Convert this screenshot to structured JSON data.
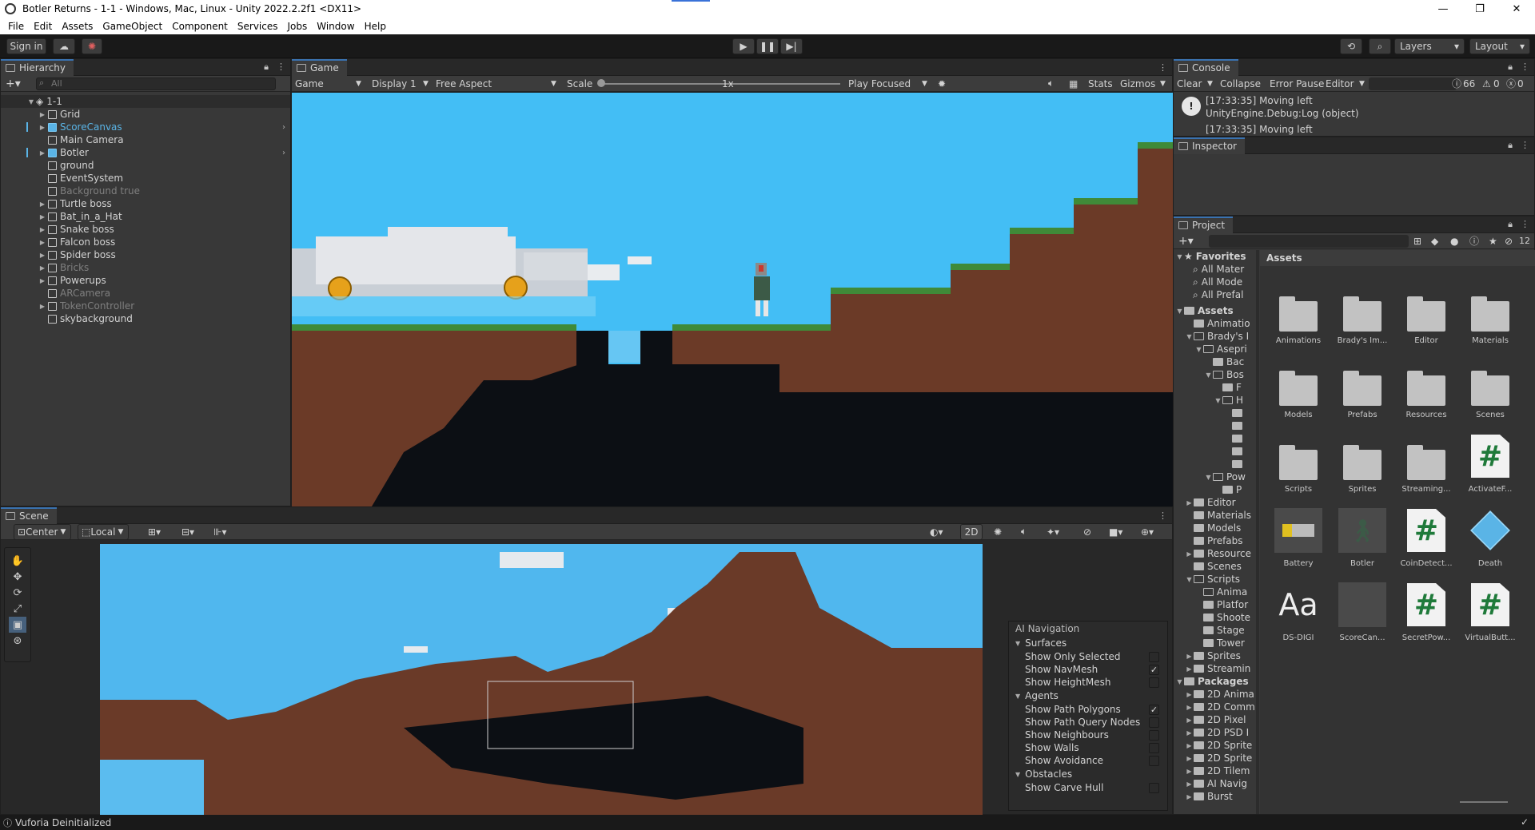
{
  "window": {
    "title": "Botler Returns - 1-1 - Windows, Mac, Linux - Unity 2022.2.2f1 <DX11>",
    "minimize": "—",
    "maximize": "❐",
    "close": "✕"
  },
  "menu": [
    "File",
    "Edit",
    "Assets",
    "GameObject",
    "Component",
    "Services",
    "Jobs",
    "Window",
    "Help"
  ],
  "toolbar": {
    "signin": "Sign in",
    "layers": "Layers",
    "layout": "Layout"
  },
  "hierarchy": {
    "tab": "Hierarchy",
    "search_placeholder": "All",
    "scene": "1-1",
    "items": [
      {
        "name": "Grid",
        "arrow": true,
        "style": "normal",
        "icon": "grid-icon"
      },
      {
        "name": "ScoreCanvas",
        "arrow": true,
        "style": "prefab",
        "icon": "cube-icon"
      },
      {
        "name": "Main Camera",
        "arrow": false,
        "style": "normal",
        "icon": "cube-icon"
      },
      {
        "name": "Botler",
        "arrow": true,
        "style": "prefab-white",
        "icon": "cube-icon"
      },
      {
        "name": "ground",
        "arrow": false,
        "style": "normal",
        "icon": "cube-icon"
      },
      {
        "name": "EventSystem",
        "arrow": false,
        "style": "normal",
        "icon": "cube-icon"
      },
      {
        "name": "Background true",
        "arrow": false,
        "style": "dim",
        "icon": "cube-icon"
      },
      {
        "name": "Turtle boss",
        "arrow": true,
        "style": "normal",
        "icon": "cube-icon"
      },
      {
        "name": "Bat_in_a_Hat",
        "arrow": true,
        "style": "normal",
        "icon": "cube-icon"
      },
      {
        "name": "Snake boss",
        "arrow": true,
        "style": "normal",
        "icon": "cube-icon"
      },
      {
        "name": "Falcon boss",
        "arrow": true,
        "style": "normal",
        "icon": "cube-icon"
      },
      {
        "name": "Spider boss",
        "arrow": true,
        "style": "normal",
        "icon": "cube-icon"
      },
      {
        "name": "Bricks",
        "arrow": true,
        "style": "dim",
        "icon": "cube-icon"
      },
      {
        "name": "Powerups",
        "arrow": true,
        "style": "normal",
        "icon": "cube-icon"
      },
      {
        "name": "ARCamera",
        "arrow": false,
        "style": "dim",
        "icon": "cube-icon"
      },
      {
        "name": "TokenController",
        "arrow": true,
        "style": "dim",
        "icon": "cube-icon"
      },
      {
        "name": "skybackground",
        "arrow": false,
        "style": "normal",
        "icon": "cube-icon"
      }
    ]
  },
  "game": {
    "tab": "Game",
    "mode": "Game",
    "display": "Display 1",
    "aspect": "Free Aspect",
    "scale_label": "Scale",
    "scale_value": "1x",
    "play_focused": "Play Focused",
    "stats": "Stats",
    "gizmos": "Gizmos"
  },
  "scene": {
    "tab": "Scene",
    "pivot": "Center",
    "space": "Local",
    "mode2d": "2D"
  },
  "ai_nav": {
    "title": "AI Navigation",
    "surfaces": "Surfaces",
    "surface_items": [
      {
        "label": "Show Only Selected",
        "checked": false
      },
      {
        "label": "Show NavMesh",
        "checked": true
      },
      {
        "label": "Show HeightMesh",
        "checked": false
      }
    ],
    "agents": "Agents",
    "agent_items": [
      {
        "label": "Show Path Polygons",
        "checked": true
      },
      {
        "label": "Show Path Query Nodes",
        "checked": false
      },
      {
        "label": "Show Neighbours",
        "checked": false
      },
      {
        "label": "Show Walls",
        "checked": false
      },
      {
        "label": "Show Avoidance",
        "checked": false
      }
    ],
    "obstacles": "Obstacles",
    "obstacle_items": [
      {
        "label": "Show Carve Hull",
        "checked": false
      }
    ]
  },
  "console": {
    "tab": "Console",
    "clear": "Clear",
    "collapse": "Collapse",
    "error_pause": "Error Pause",
    "editor": "Editor",
    "count_info": "66",
    "count_warn": "0",
    "count_err": "0",
    "log_line1": "[17:33:35] Moving left",
    "log_line2": "UnityEngine.Debug:Log (object)",
    "log_line3": "[17:33:35] Moving left"
  },
  "inspector": {
    "tab": "Inspector"
  },
  "project": {
    "tab": "Project",
    "hidden_count": "12",
    "breadcrumb": "Assets",
    "favorites": "Favorites",
    "fav_items": [
      "All Mater",
      "All Mode",
      "All Prefal"
    ],
    "tree": [
      {
        "label": "Assets",
        "depth": 0,
        "arrow": "▼",
        "bold": true,
        "type": "fi"
      },
      {
        "label": "Animatio",
        "depth": 1,
        "arrow": "",
        "type": "fi"
      },
      {
        "label": "Brady's I",
        "depth": 1,
        "arrow": "▼",
        "type": "fo"
      },
      {
        "label": "Asepri",
        "depth": 2,
        "arrow": "▼",
        "type": "fo"
      },
      {
        "label": "Bac",
        "depth": 3,
        "arrow": "",
        "type": "fi"
      },
      {
        "label": "Bos",
        "depth": 3,
        "arrow": "▼",
        "type": "fo"
      },
      {
        "label": "F",
        "depth": 4,
        "arrow": "",
        "type": "fi"
      },
      {
        "label": "H",
        "depth": 4,
        "arrow": "▼",
        "type": "fo"
      },
      {
        "label": "",
        "depth": 5,
        "arrow": "",
        "type": "fi"
      },
      {
        "label": "",
        "depth": 5,
        "arrow": "",
        "type": "fi"
      },
      {
        "label": "",
        "depth": 5,
        "arrow": "",
        "type": "fi"
      },
      {
        "label": "",
        "depth": 5,
        "arrow": "",
        "type": "fi"
      },
      {
        "label": "",
        "depth": 5,
        "arrow": "",
        "type": "fi"
      },
      {
        "label": "Pow",
        "depth": 3,
        "arrow": "▼",
        "type": "fo"
      },
      {
        "label": "P",
        "depth": 4,
        "arrow": "",
        "type": "fi"
      },
      {
        "label": "Editor",
        "depth": 1,
        "arrow": "▶",
        "type": "fi"
      },
      {
        "label": "Materials",
        "depth": 1,
        "arrow": "",
        "type": "fi"
      },
      {
        "label": "Models",
        "depth": 1,
        "arrow": "",
        "type": "fi"
      },
      {
        "label": "Prefabs",
        "depth": 1,
        "arrow": "",
        "type": "fi"
      },
      {
        "label": "Resource",
        "depth": 1,
        "arrow": "▶",
        "type": "fi"
      },
      {
        "label": "Scenes",
        "depth": 1,
        "arrow": "",
        "type": "fi"
      },
      {
        "label": "Scripts",
        "depth": 1,
        "arrow": "▼",
        "type": "fo"
      },
      {
        "label": "Anima",
        "depth": 2,
        "arrow": "",
        "type": "fo"
      },
      {
        "label": "Platfor",
        "depth": 2,
        "arrow": "",
        "type": "fi"
      },
      {
        "label": "Shoote",
        "depth": 2,
        "arrow": "",
        "type": "fi"
      },
      {
        "label": "Stage",
        "depth": 2,
        "arrow": "",
        "type": "fi"
      },
      {
        "label": "Tower",
        "depth": 2,
        "arrow": "",
        "type": "fi"
      },
      {
        "label": "Sprites",
        "depth": 1,
        "arrow": "▶",
        "type": "fi"
      },
      {
        "label": "Streamin",
        "depth": 1,
        "arrow": "▶",
        "type": "fi"
      },
      {
        "label": "Packages",
        "depth": 0,
        "arrow": "▼",
        "bold": true,
        "type": "fi"
      },
      {
        "label": "2D Anima",
        "depth": 1,
        "arrow": "▶",
        "type": "fi"
      },
      {
        "label": "2D Comm",
        "depth": 1,
        "arrow": "▶",
        "type": "fi"
      },
      {
        "label": "2D Pixel",
        "depth": 1,
        "arrow": "▶",
        "type": "fi"
      },
      {
        "label": "2D PSD I",
        "depth": 1,
        "arrow": "▶",
        "type": "fi"
      },
      {
        "label": "2D Sprite",
        "depth": 1,
        "arrow": "▶",
        "type": "fi"
      },
      {
        "label": "2D Sprite",
        "depth": 1,
        "arrow": "▶",
        "type": "fi"
      },
      {
        "label": "2D Tilem",
        "depth": 1,
        "arrow": "▶",
        "type": "fi"
      },
      {
        "label": "AI Navig",
        "depth": 1,
        "arrow": "▶",
        "type": "fi"
      },
      {
        "label": "Burst",
        "depth": 1,
        "arrow": "▶",
        "type": "fi"
      }
    ],
    "assets": [
      {
        "label": "Animations",
        "kind": "folder"
      },
      {
        "label": "Brady's Im...",
        "kind": "folder"
      },
      {
        "label": "Editor",
        "kind": "folder"
      },
      {
        "label": "Materials",
        "kind": "folder"
      },
      {
        "label": "Models",
        "kind": "folder"
      },
      {
        "label": "Prefabs",
        "kind": "folder"
      },
      {
        "label": "Resources",
        "kind": "folder"
      },
      {
        "label": "Scenes",
        "kind": "folder"
      },
      {
        "label": "Scripts",
        "kind": "folder"
      },
      {
        "label": "Sprites",
        "kind": "folder"
      },
      {
        "label": "Streaming...",
        "kind": "folder"
      },
      {
        "label": "ActivateF...",
        "kind": "script"
      },
      {
        "label": "Battery",
        "kind": "battery"
      },
      {
        "label": "Botler",
        "kind": "botler"
      },
      {
        "label": "CoinDetect...",
        "kind": "script"
      },
      {
        "label": "Death",
        "kind": "cube"
      },
      {
        "label": "DS-DIGI",
        "kind": "font"
      },
      {
        "label": "ScoreCan...",
        "kind": "blank"
      },
      {
        "label": "SecretPow...",
        "kind": "script"
      },
      {
        "label": "VirtualButt...",
        "kind": "script"
      }
    ]
  },
  "status": {
    "text": "Vuforia Deinitialized"
  }
}
